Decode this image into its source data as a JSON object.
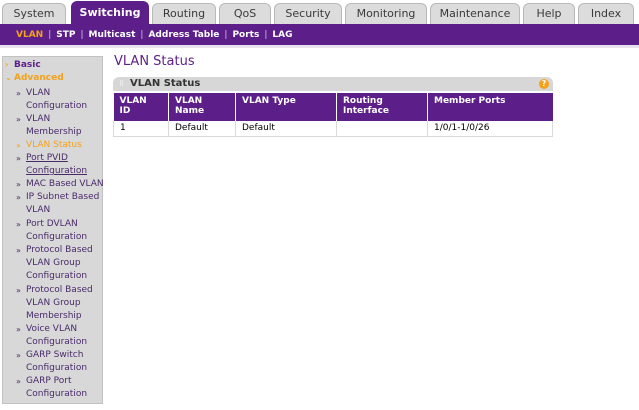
{
  "top_tabs": [
    {
      "label": "System",
      "active": false
    },
    {
      "label": "Switching",
      "active": true
    },
    {
      "label": "Routing",
      "active": false
    },
    {
      "label": "QoS",
      "active": false
    },
    {
      "label": "Security",
      "active": false
    },
    {
      "label": "Monitoring",
      "active": false
    },
    {
      "label": "Maintenance",
      "active": false
    },
    {
      "label": "Help",
      "active": false
    },
    {
      "label": "Index",
      "active": false
    }
  ],
  "subnav": [
    {
      "label": "VLAN",
      "active": true
    },
    {
      "label": "STP",
      "active": false
    },
    {
      "label": "Multicast",
      "active": false
    },
    {
      "label": "Address Table",
      "active": false
    },
    {
      "label": "Ports",
      "active": false
    },
    {
      "label": "LAG",
      "active": false
    }
  ],
  "sidebar": {
    "basic_label": "Basic",
    "advanced_label": "Advanced",
    "items": [
      {
        "label": "VLAN Configuration",
        "lines": [
          "VLAN",
          "Configuration"
        ]
      },
      {
        "label": "VLAN Membership",
        "lines": [
          "VLAN",
          "Membership"
        ]
      },
      {
        "label": "VLAN Status",
        "lines": [
          "VLAN Status"
        ]
      },
      {
        "label": "Port PVID Configuration",
        "lines": [
          "Port PVID",
          "Configuration"
        ]
      },
      {
        "label": "MAC Based VLAN",
        "lines": [
          "MAC Based VLAN"
        ]
      },
      {
        "label": "IP Subnet Based VLAN",
        "lines": [
          "IP Subnet Based",
          "VLAN"
        ]
      },
      {
        "label": "Port DVLAN Configuration",
        "lines": [
          "Port DVLAN",
          "Configuration"
        ]
      },
      {
        "label": "Protocol Based VLAN Group Configuration",
        "lines": [
          "Protocol Based",
          "VLAN Group",
          "Configuration"
        ]
      },
      {
        "label": "Protocol Based VLAN Group Membership",
        "lines": [
          "Protocol Based",
          "VLAN Group",
          "Membership"
        ]
      },
      {
        "label": "Voice VLAN Configuration",
        "lines": [
          "Voice VLAN",
          "Configuration"
        ]
      },
      {
        "label": "GARP Switch Configuration",
        "lines": [
          "GARP Switch",
          "Configuration"
        ]
      },
      {
        "label": "GARP Port Configuration",
        "lines": [
          "GARP Port",
          "Configuration"
        ]
      }
    ]
  },
  "main": {
    "page_title": "VLAN Status",
    "panel_title": "VLAN Status",
    "help_symbol": "?",
    "table": {
      "headers": [
        [
          "VLAN",
          "ID"
        ],
        [
          "VLAN",
          "Name"
        ],
        [
          "VLAN Type"
        ],
        [
          "Routing",
          "Interface"
        ],
        [
          "Member Ports"
        ]
      ],
      "rows": [
        [
          "1",
          "Default",
          "Default",
          "",
          "1/0/1-1/0/26"
        ]
      ]
    }
  },
  "colors": {
    "brand_purple": "#5c1f89",
    "accent_orange": "#f4a11b"
  }
}
